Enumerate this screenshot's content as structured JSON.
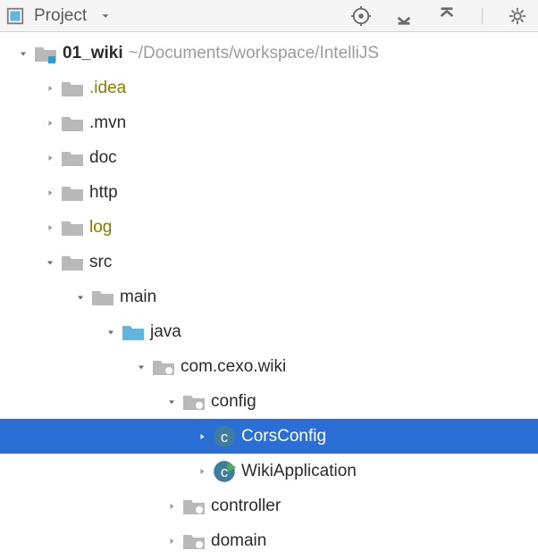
{
  "toolbar": {
    "title": "Project"
  },
  "project": {
    "name": "01_wiki",
    "path": "~/Documents/workspace/IntelliJS"
  },
  "tree": {
    "idea": ".idea",
    "mvn": ".mvn",
    "doc": "doc",
    "http": "http",
    "log": "log",
    "src": "src",
    "main": "main",
    "java": "java",
    "pkg": "com.cexo.wiki",
    "config": "config",
    "cors": "CorsConfig",
    "wikiapp": "WikiApplication",
    "controller": "controller",
    "domain": "domain"
  },
  "colors": {
    "olive": "#808000",
    "blueFolder": "#63b5db",
    "grayFolder": "#b9b9b9",
    "selection": "#2b6ed6",
    "classBadge": "#3e7e9c"
  }
}
